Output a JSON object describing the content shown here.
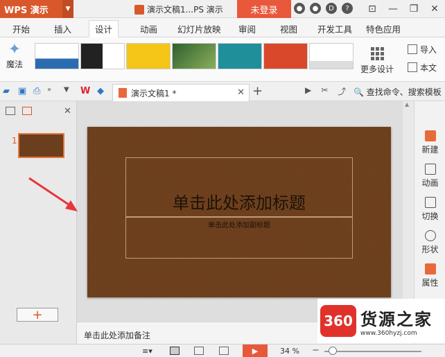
{
  "titlebar": {
    "app_name": "WPS 演示",
    "doc_title": "演示文稿1...PS 演示",
    "login": "未登录"
  },
  "menu": {
    "tabs": [
      "开始",
      "插入",
      "设计",
      "动画",
      "幻灯片放映",
      "审阅",
      "视图",
      "开发工具",
      "特色应用"
    ],
    "active": "设计"
  },
  "ribbon": {
    "magic": "魔法",
    "more_design": "更多设计",
    "import": "导入",
    "this_doc": "本文"
  },
  "doctabs": {
    "active_tab": "演示文稿1 *",
    "search": "查找命令、搜索模板"
  },
  "slide": {
    "title_placeholder": "单击此处添加标题",
    "subtitle_placeholder": "单击此处添加副标题",
    "number": "1"
  },
  "notes": {
    "placeholder": "单击此处添加备注"
  },
  "sidepanel": {
    "items": [
      "新建",
      "动画",
      "切换",
      "形状",
      "属性"
    ]
  },
  "status": {
    "zoom": "34 %"
  },
  "watermark": {
    "badge": "360",
    "name": "货源之家",
    "url": "www.360hyzj.com"
  },
  "colors": {
    "accent": "#d9582b",
    "slide_bg": "#6d401e",
    "arrow": "#e8353a"
  }
}
